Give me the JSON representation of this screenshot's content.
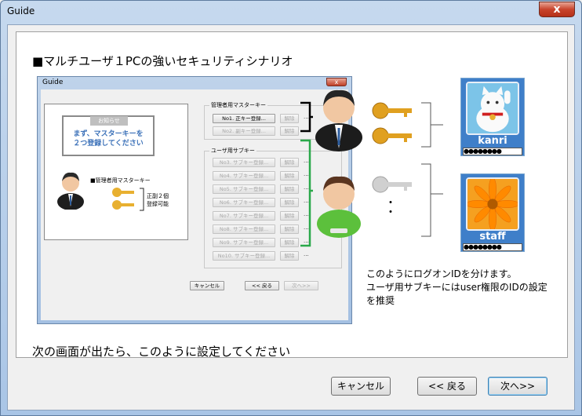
{
  "window": {
    "title": "Guide",
    "close_glyph": "x"
  },
  "main": {
    "heading": "■マルチユーザ１PCの強いセキュリティシナリオ",
    "bottom_text": "次の画面が出たら、このように設定してください",
    "description": [
      "このようにログオンIDを分けます。",
      "ユーザ用サブキーにはuser権限のIDの設定",
      "を推奨"
    ],
    "users": [
      {
        "name": "kanri",
        "password": "●●●●●●●●"
      },
      {
        "name": "staff",
        "password": "●●●●●●●●"
      }
    ],
    "ellipsis": "・\n・"
  },
  "buttons": {
    "cancel": "キャンセル",
    "back": "<< 戻る",
    "next": "次へ>>"
  },
  "mini": {
    "title": "Guide",
    "close_glyph": "x",
    "notice_title": "お知らせ",
    "notice_lines": [
      "まず、マスターキーを",
      "２つ登録してください"
    ],
    "master_label": "■管理者用マスターキー",
    "key_note": [
      "正副２個",
      "登録可能"
    ],
    "group_master_title": "管理者用マスターキー",
    "group_sub_title": "ユーザ用サブキー",
    "master_buttons": [
      "No1. 正キー登録...",
      "No2. 副キー登録..."
    ],
    "sub_buttons": [
      "No3. サブキー登録...",
      "No4. サブキー登録...",
      "No5. サブキー登録...",
      "No6. サブキー登録...",
      "No7. サブキー登録...",
      "No8. サブキー登録...",
      "No9. サブキー登録...",
      "No10. サブキー登録..."
    ],
    "remove_label": "解除",
    "dots": "...",
    "cancel": "キャンセル",
    "back": "<< 戻る",
    "next": "次へ>>"
  },
  "colors": {
    "bracket_green": "#2aa84a",
    "key_gold": "#e0a020",
    "key_gray": "#c8c8c8",
    "accent_blue": "#3a70b8"
  }
}
